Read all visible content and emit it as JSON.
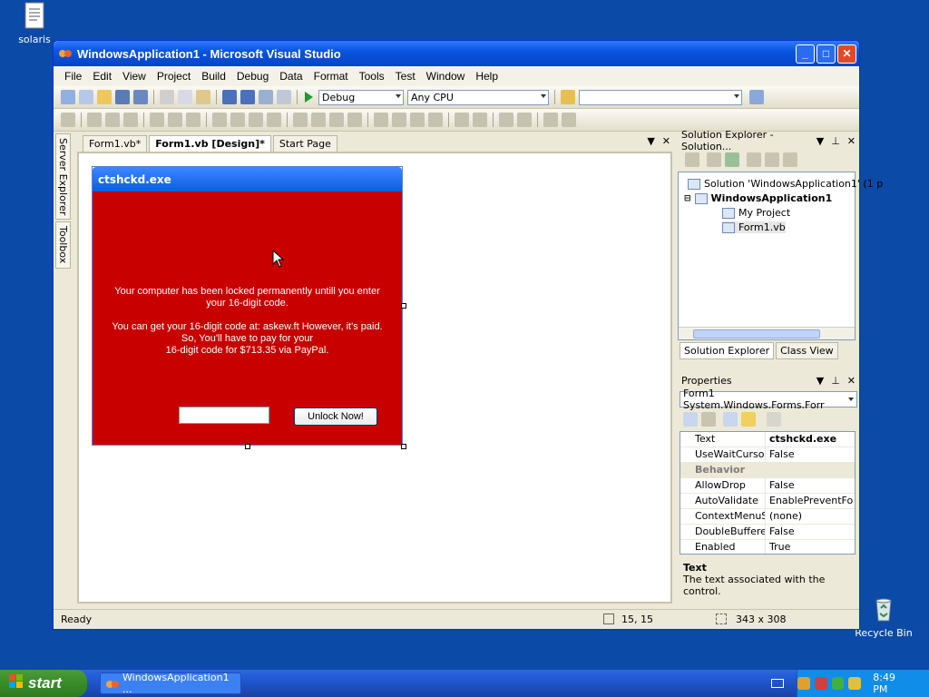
{
  "desktop": {
    "icons": [
      {
        "label": "solaris",
        "icon": "document-icon"
      },
      {
        "label": "Recycle Bin",
        "icon": "recycle-bin-icon"
      }
    ]
  },
  "window": {
    "title": "WindowsApplication1 - Microsoft Visual Studio",
    "buttons": {
      "minimize": "_",
      "maximize": "□",
      "close": "✕"
    }
  },
  "menu": [
    "File",
    "Edit",
    "View",
    "Project",
    "Build",
    "Debug",
    "Data",
    "Format",
    "Tools",
    "Test",
    "Window",
    "Help"
  ],
  "toolbar": {
    "config": "Debug",
    "platform": "Any CPU",
    "find": ""
  },
  "left_dock": {
    "server_explorer": "Server Explorer",
    "toolbox": "Toolbox"
  },
  "doc_tabs": [
    {
      "label": "Form1.vb*",
      "active": false
    },
    {
      "label": "Form1.vb [Design]*",
      "active": true
    },
    {
      "label": "Start Page",
      "active": false
    }
  ],
  "form": {
    "title": "ctshckd.exe",
    "body_color": "#c80000",
    "message1": "Your computer has been locked permanently untill you enter your 16-digit code.",
    "message2_line1": "You can get your 16-digit code at: askew.ft However, it's paid. So, You'll have to pay for your",
    "message2_line2": "16-digit code for $713.35 via PayPal.",
    "code_input_value": "",
    "unlock_button": "Unlock Now!"
  },
  "solution_explorer": {
    "title": "Solution Explorer - Solution...",
    "tree": [
      {
        "label": "Solution 'WindowsApplication1' (1 p"
      },
      {
        "label": "WindowsApplication1"
      },
      {
        "label": "My Project"
      },
      {
        "label": "Form1.vb"
      }
    ],
    "tabs": [
      "Solution Explorer",
      "Class View"
    ]
  },
  "properties": {
    "title": "Properties",
    "object": "Form1  System.Windows.Forms.Forr",
    "rows": [
      {
        "name": "Text",
        "value": "ctshckd.exe",
        "bold": true
      },
      {
        "name": "UseWaitCursor",
        "value": "False"
      },
      {
        "name": "Behavior",
        "value": "",
        "category": true
      },
      {
        "name": "AllowDrop",
        "value": "False"
      },
      {
        "name": "AutoValidate",
        "value": "EnablePreventFo"
      },
      {
        "name": "ContextMenuStr",
        "value": "(none)"
      },
      {
        "name": "DoubleBuffered",
        "value": "False"
      },
      {
        "name": "Enabled",
        "value": "True"
      }
    ],
    "desc_title": "Text",
    "desc_text": "The text associated with the control."
  },
  "status": {
    "text": "Ready",
    "position": "15, 15",
    "size": "343 x 308"
  },
  "taskbar": {
    "start": "start",
    "task": "WindowsApplication1 ...",
    "clock": "8:49 PM"
  }
}
